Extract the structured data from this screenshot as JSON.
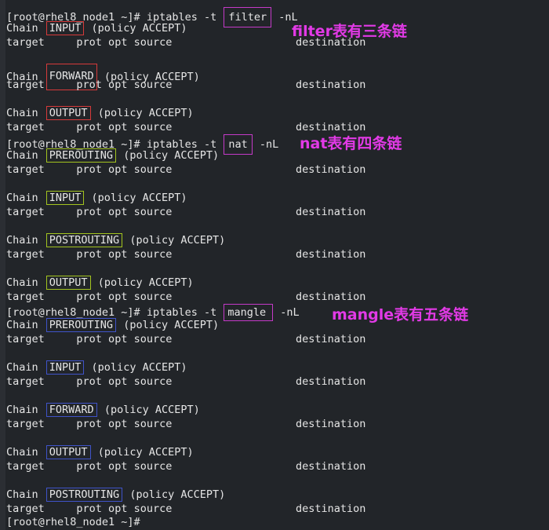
{
  "terminal": {
    "prompt": "[root@rhel8_node1 ~]#",
    "cmd_prefix": " iptables -t ",
    "cmd_suffix": " -nL",
    "final_prompt": "[root@rhel8_node1 ~]#"
  },
  "header_cols": {
    "target": "target",
    "prot_opt_source": "prot opt source",
    "destination": "destination"
  },
  "chain_label": "Chain",
  "policy_text": "(policy ACCEPT)",
  "tables": [
    {
      "name": "filter",
      "annotation": "filter表有三条链",
      "chains": [
        "INPUT",
        "FORWARD",
        "OUTPUT"
      ]
    },
    {
      "name": "nat",
      "annotation": "nat表有四条链",
      "chains": [
        "PREROUTING",
        "INPUT",
        "POSTROUTING",
        "OUTPUT"
      ]
    },
    {
      "name": "mangle",
      "annotation": "mangle表有五条链",
      "chains": [
        "PREROUTING",
        "INPUT",
        "FORWARD",
        "OUTPUT",
        "POSTROUTING"
      ]
    }
  ],
  "colors": {
    "filter_box": "#d63a3a",
    "nat_box": "#a3c41f",
    "mangle_box": "#3f53c9",
    "command_box": "#c43ac8",
    "annotation_text": "#e23ae6"
  }
}
